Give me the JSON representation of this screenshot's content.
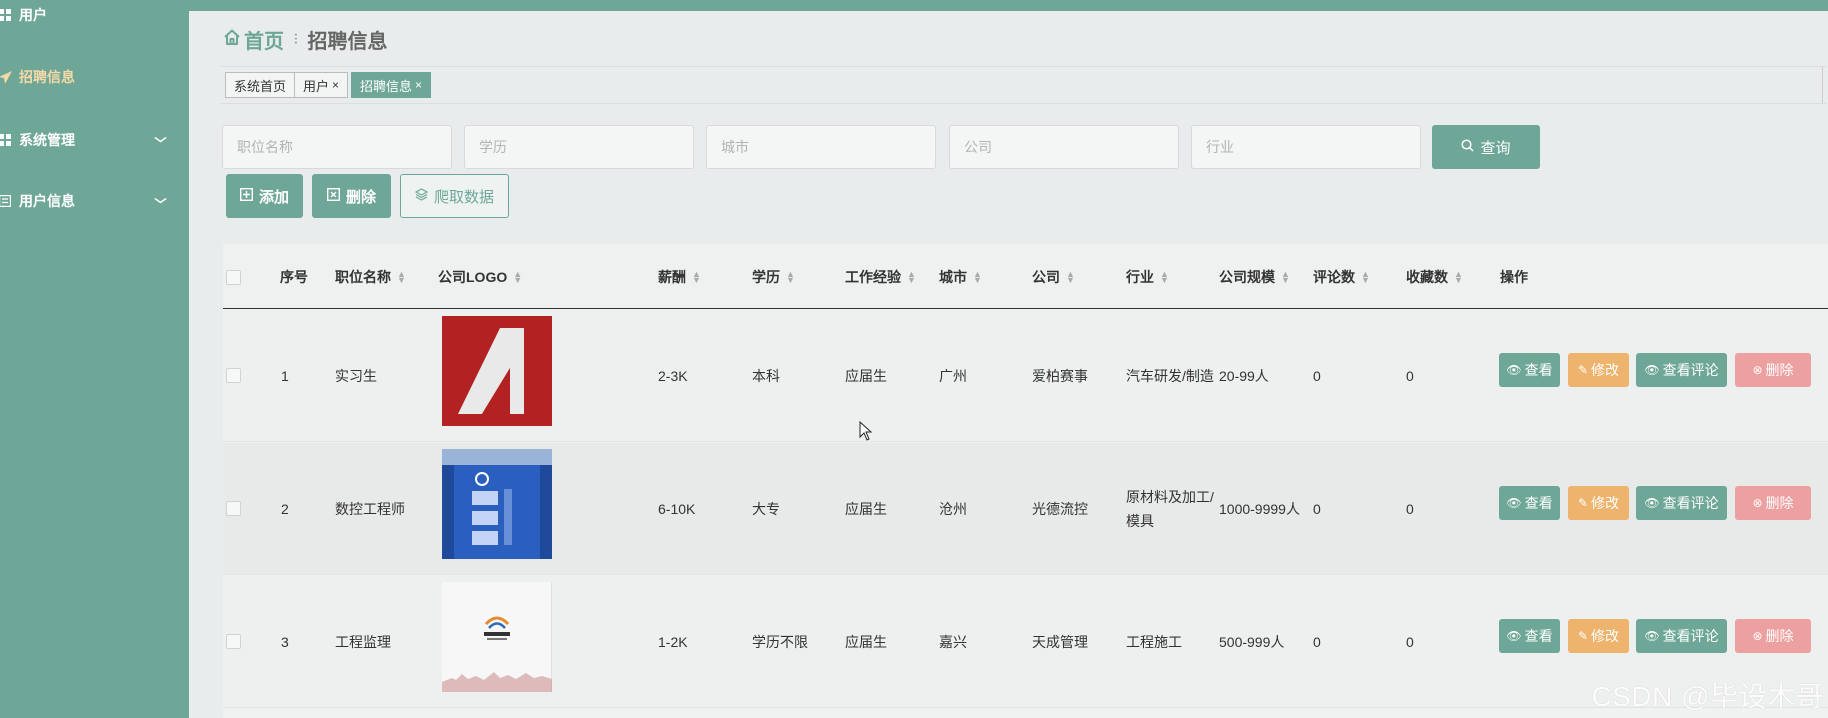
{
  "sidebar": {
    "items": [
      {
        "label": "用户",
        "icon": "grid-icon",
        "active": false
      },
      {
        "label": "招聘信息",
        "icon": "send-icon",
        "active": true
      },
      {
        "label": "系统管理",
        "icon": "grid-icon",
        "expandable": true
      },
      {
        "label": "用户信息",
        "icon": "list-icon",
        "expandable": true
      }
    ]
  },
  "breadcrumb": {
    "home": "首页",
    "separator": "⫶",
    "current": "招聘信息"
  },
  "tabs": [
    {
      "label": "系统首页",
      "closable": false,
      "active": false
    },
    {
      "label": "用户",
      "closable": true,
      "active": false
    },
    {
      "label": "招聘信息",
      "closable": true,
      "active": true
    }
  ],
  "tab_close": "×",
  "search": {
    "fields": [
      {
        "placeholder": "职位名称",
        "value": ""
      },
      {
        "placeholder": "学历",
        "value": ""
      },
      {
        "placeholder": "城市",
        "value": ""
      },
      {
        "placeholder": "公司",
        "value": ""
      },
      {
        "placeholder": "行业",
        "value": ""
      }
    ],
    "query_label": "查询"
  },
  "actions": {
    "add": "添加",
    "delete": "删除",
    "crawl": "爬取数据"
  },
  "table": {
    "headers": [
      "序号",
      "职位名称",
      "公司LOGO",
      "薪酬",
      "学历",
      "工作经验",
      "城市",
      "公司",
      "行业",
      "公司规模",
      "评论数",
      "收藏数",
      "操作"
    ],
    "rows": [
      {
        "no": "1",
        "title": "实习生",
        "salary": "2-3K",
        "edu": "本科",
        "exp": "应届生",
        "city": "广州",
        "company": "爱柏赛事",
        "industry": "汽车研发/制造",
        "scale": "20-99人",
        "comments": "0",
        "favs": "0"
      },
      {
        "no": "2",
        "title": "数控工程师",
        "salary": "6-10K",
        "edu": "大专",
        "exp": "应届生",
        "city": "沧州",
        "company": "光德流控",
        "industry": "原材料及加工/模具",
        "scale": "1000-9999人",
        "comments": "0",
        "favs": "0"
      },
      {
        "no": "3",
        "title": "工程监理",
        "salary": "1-2K",
        "edu": "学历不限",
        "exp": "应届生",
        "city": "嘉兴",
        "company": "天成管理",
        "industry": "工程施工",
        "scale": "500-999人",
        "comments": "0",
        "favs": "0"
      }
    ],
    "ops": {
      "view": "查看",
      "edit": "修改",
      "comments": "查看评论",
      "delete": "删除"
    }
  },
  "watermark": "CSDN @毕设木哥",
  "colors": {
    "accent": "#6ea797",
    "edit": "#eeb36d",
    "danger": "#eda0a0",
    "active_nav": "#f4d9a6"
  }
}
